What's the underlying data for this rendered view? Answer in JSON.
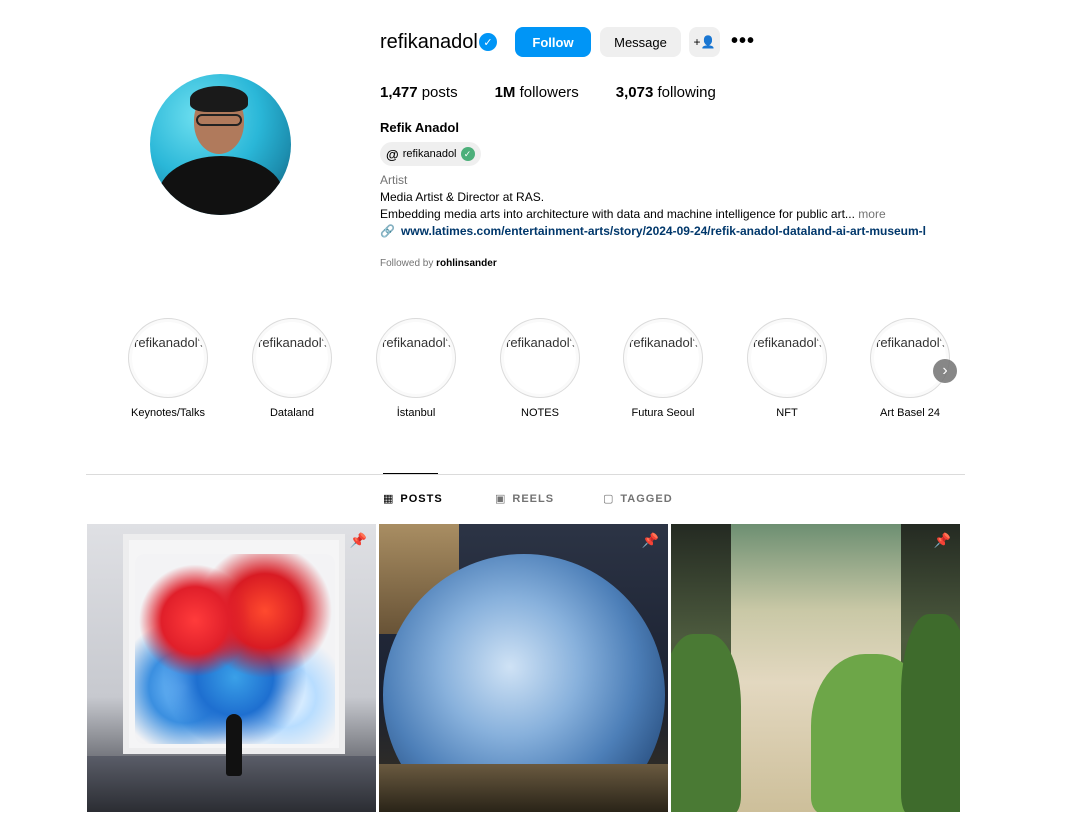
{
  "profile": {
    "username": "refikanadol",
    "follow_label": "Follow",
    "message_label": "Message",
    "add_user_icon": "+👤",
    "more_icon": "•••",
    "stats": {
      "posts_count": "1,477",
      "posts_label": "posts",
      "followers_count": "1M",
      "followers_label": "followers",
      "following_count": "3,073",
      "following_label": "following"
    },
    "full_name": "Refik Anadol",
    "threads_handle": "refikanadol",
    "category": "Artist",
    "bio_line1": "Media Artist & Director at RAS.",
    "bio_line2": "Embedding media arts into architecture with data and machine intelligence for public art...",
    "bio_more": "more",
    "link": "www.latimes.com/entertainment-arts/story/2024-09-24/refik-anadol-dataland-ai-art-museum-l",
    "followed_by_prefix": "Followed by",
    "followed_by_user": "rohlinsander"
  },
  "highlights": {
    "alt_text": "refikanadol's highlight story picture",
    "items": [
      {
        "label": "Keynotes/Talks"
      },
      {
        "label": "Dataland"
      },
      {
        "label": "İstanbul"
      },
      {
        "label": "NOTES"
      },
      {
        "label": "Futura Seoul"
      },
      {
        "label": "NFT"
      },
      {
        "label": "Art Basel 24"
      }
    ]
  },
  "tabs": {
    "posts": "POSTS",
    "reels": "REELS",
    "tagged": "TAGGED"
  },
  "colors": {
    "accent": "#0095f6",
    "secondary_button": "#efefef",
    "muted_text": "#737373",
    "link_text": "#00376b"
  }
}
